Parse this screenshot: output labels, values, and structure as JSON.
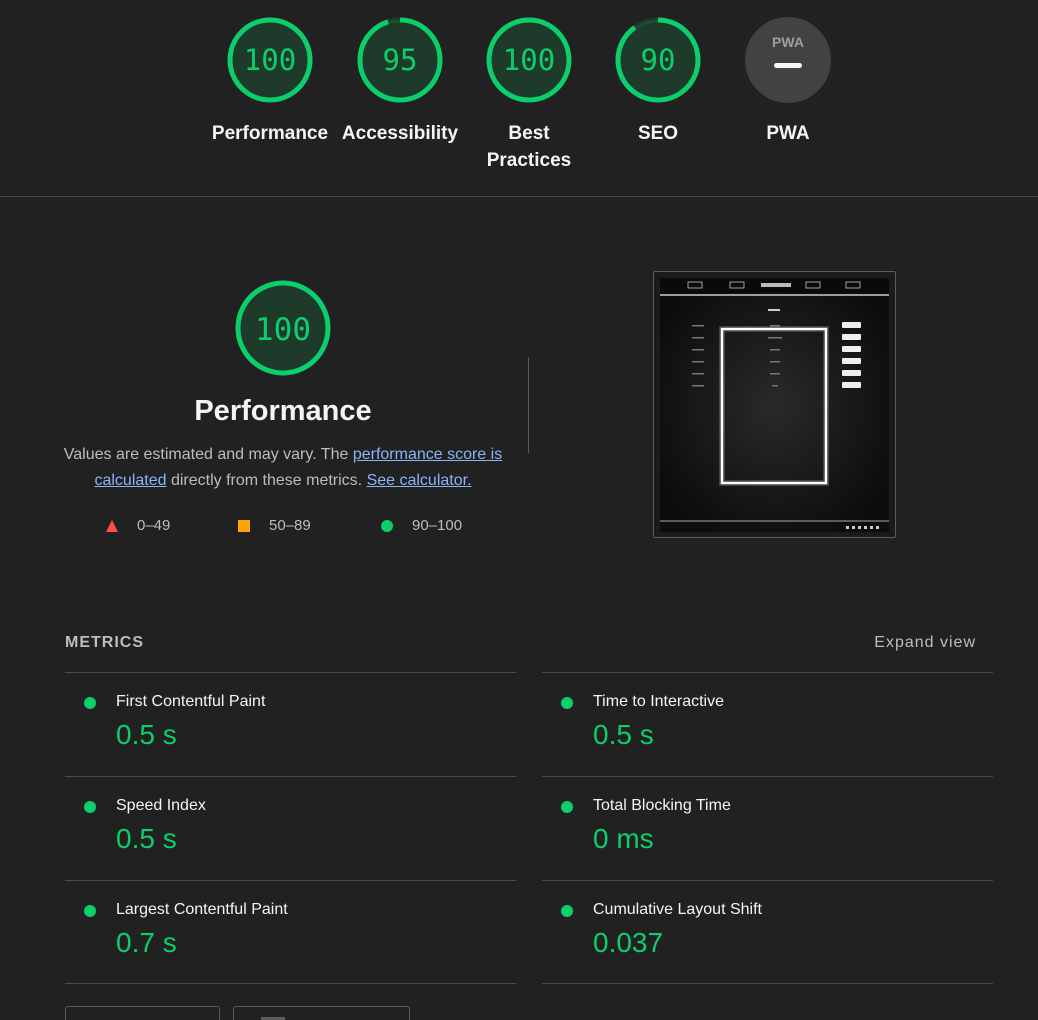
{
  "gauges": [
    {
      "score": "100",
      "label": "Performance",
      "fraction": 1.0
    },
    {
      "score": "95",
      "label": "Accessibility",
      "fraction": 0.95
    },
    {
      "score": "100",
      "label": "Best Practices",
      "fraction": 1.0
    },
    {
      "score": "90",
      "label": "SEO",
      "fraction": 0.9
    },
    {
      "score": "PWA",
      "label": "PWA",
      "fraction": 0
    }
  ],
  "colors": {
    "pass": "#0cce6b",
    "average": "#ffa400",
    "fail": "#ff4e42",
    "background": "#212121"
  },
  "performance": {
    "score": "100",
    "title": "Performance",
    "desc_pre": "Values are estimated and may vary. The ",
    "desc_link1": "performance score is calculated",
    "desc_mid": " directly from these metrics. ",
    "desc_link2": "See calculator."
  },
  "legend": [
    {
      "range": "0–49",
      "shape": "triangle-icon"
    },
    {
      "range": "50–89",
      "shape": "square-icon"
    },
    {
      "range": "90–100",
      "shape": "circle-icon"
    }
  ],
  "metrics": {
    "header": "METRICS",
    "expand_label": "Expand view",
    "items": [
      {
        "label": "First Contentful Paint",
        "value": "0.5 s"
      },
      {
        "label": "Time to Interactive",
        "value": "0.5 s"
      },
      {
        "label": "Speed Index",
        "value": "0.5 s"
      },
      {
        "label": "Total Blocking Time",
        "value": "0 ms"
      },
      {
        "label": "Largest Contentful Paint",
        "value": "0.7 s"
      },
      {
        "label": "Cumulative Layout Shift",
        "value": "0.037"
      }
    ]
  }
}
